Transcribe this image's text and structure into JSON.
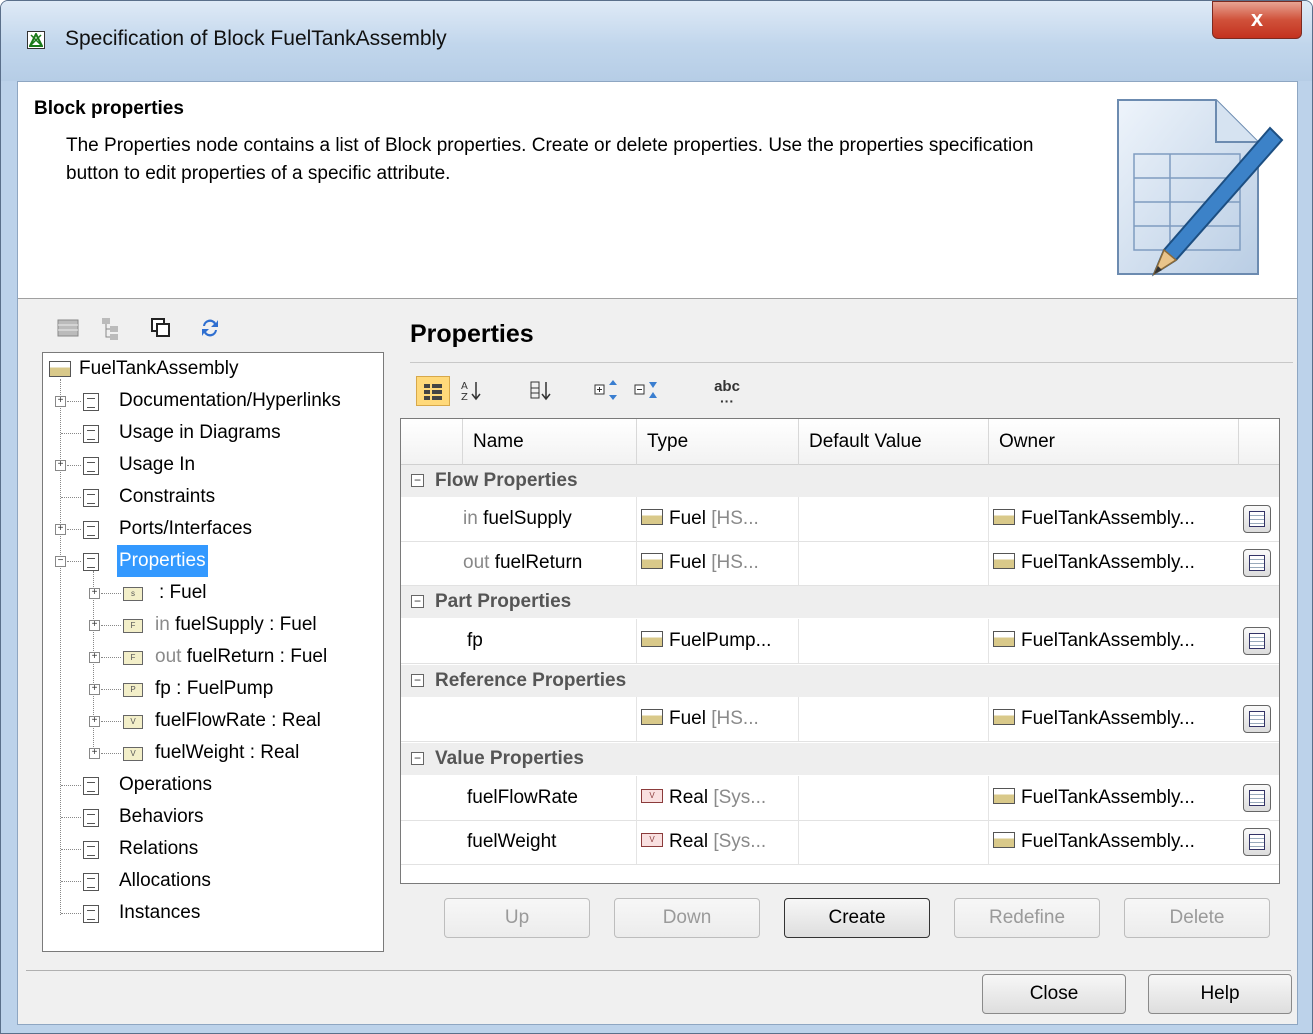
{
  "window": {
    "title": "Specification of Block FuelTankAssembly",
    "close_label": "x"
  },
  "header": {
    "title": "Block properties",
    "description": "The Properties node contains a list of Block properties. Create or delete properties. Use the properties specification button to edit properties of a specific attribute."
  },
  "tree": {
    "root": "FuelTankAssembly",
    "items": [
      {
        "label": "Documentation/Hyperlinks",
        "expandable": true
      },
      {
        "label": "Usage in Diagrams",
        "expandable": false
      },
      {
        "label": "Usage In",
        "expandable": true
      },
      {
        "label": "Constraints",
        "expandable": false
      },
      {
        "label": "Ports/Interfaces",
        "expandable": true
      },
      {
        "label": "Properties",
        "expandable": true,
        "selected": true
      },
      {
        "label": "Operations",
        "expandable": false
      },
      {
        "label": "Behaviors",
        "expandable": false
      },
      {
        "label": "Relations",
        "expandable": false
      },
      {
        "label": "Allocations",
        "expandable": false
      },
      {
        "label": "Instances",
        "expandable": false
      }
    ],
    "property_children": [
      {
        "dir": "",
        "name": "",
        "type": " : Fuel",
        "icon": "s"
      },
      {
        "dir": "in ",
        "name": "fuelSupply",
        "type": " : Fuel",
        "icon": "F"
      },
      {
        "dir": "out ",
        "name": "fuelReturn",
        "type": " : Fuel",
        "icon": "F"
      },
      {
        "dir": "",
        "name": "fp",
        "type": " : FuelPump",
        "icon": "P"
      },
      {
        "dir": "",
        "name": "fuelFlowRate",
        "type": " : Real",
        "icon": "V"
      },
      {
        "dir": "",
        "name": "fuelWeight",
        "type": " : Real",
        "icon": "V"
      }
    ]
  },
  "properties": {
    "title": "Properties",
    "columns": [
      "Name",
      "Type",
      "Default Value",
      "Owner"
    ],
    "groups": [
      {
        "label": "Flow Properties",
        "rows": [
          {
            "dir": "in",
            "name": "fuelSupply",
            "type": "Fuel",
            "type_extra": "[HS...",
            "type_icon": "block",
            "default": "",
            "owner": "FuelTankAssembly..."
          },
          {
            "dir": "out",
            "name": "fuelReturn",
            "type": "Fuel",
            "type_extra": "[HS...",
            "type_icon": "block",
            "default": "",
            "owner": "FuelTankAssembly..."
          }
        ]
      },
      {
        "label": "Part Properties",
        "rows": [
          {
            "dir": "",
            "name": "fp",
            "type": "FuelPump...",
            "type_extra": "",
            "type_icon": "block",
            "default": "",
            "owner": "FuelTankAssembly..."
          }
        ]
      },
      {
        "label": "Reference Properties",
        "rows": [
          {
            "dir": "",
            "name": "",
            "type": "Fuel",
            "type_extra": "[HS...",
            "type_icon": "block",
            "default": "",
            "owner": "FuelTankAssembly..."
          }
        ]
      },
      {
        "label": "Value Properties",
        "rows": [
          {
            "dir": "",
            "name": "fuelFlowRate",
            "type": "Real",
            "type_extra": "[Sys...",
            "type_icon": "value",
            "default": "",
            "owner": "FuelTankAssembly..."
          },
          {
            "dir": "",
            "name": "fuelWeight",
            "type": "Real",
            "type_extra": "[Sys...",
            "type_icon": "value",
            "default": "",
            "owner": "FuelTankAssembly..."
          }
        ]
      }
    ],
    "toolbar_abc": "abc"
  },
  "buttons": {
    "up": "Up",
    "down": "Down",
    "create": "Create",
    "redefine": "Redefine",
    "delete": "Delete",
    "close": "Close",
    "help": "Help"
  }
}
